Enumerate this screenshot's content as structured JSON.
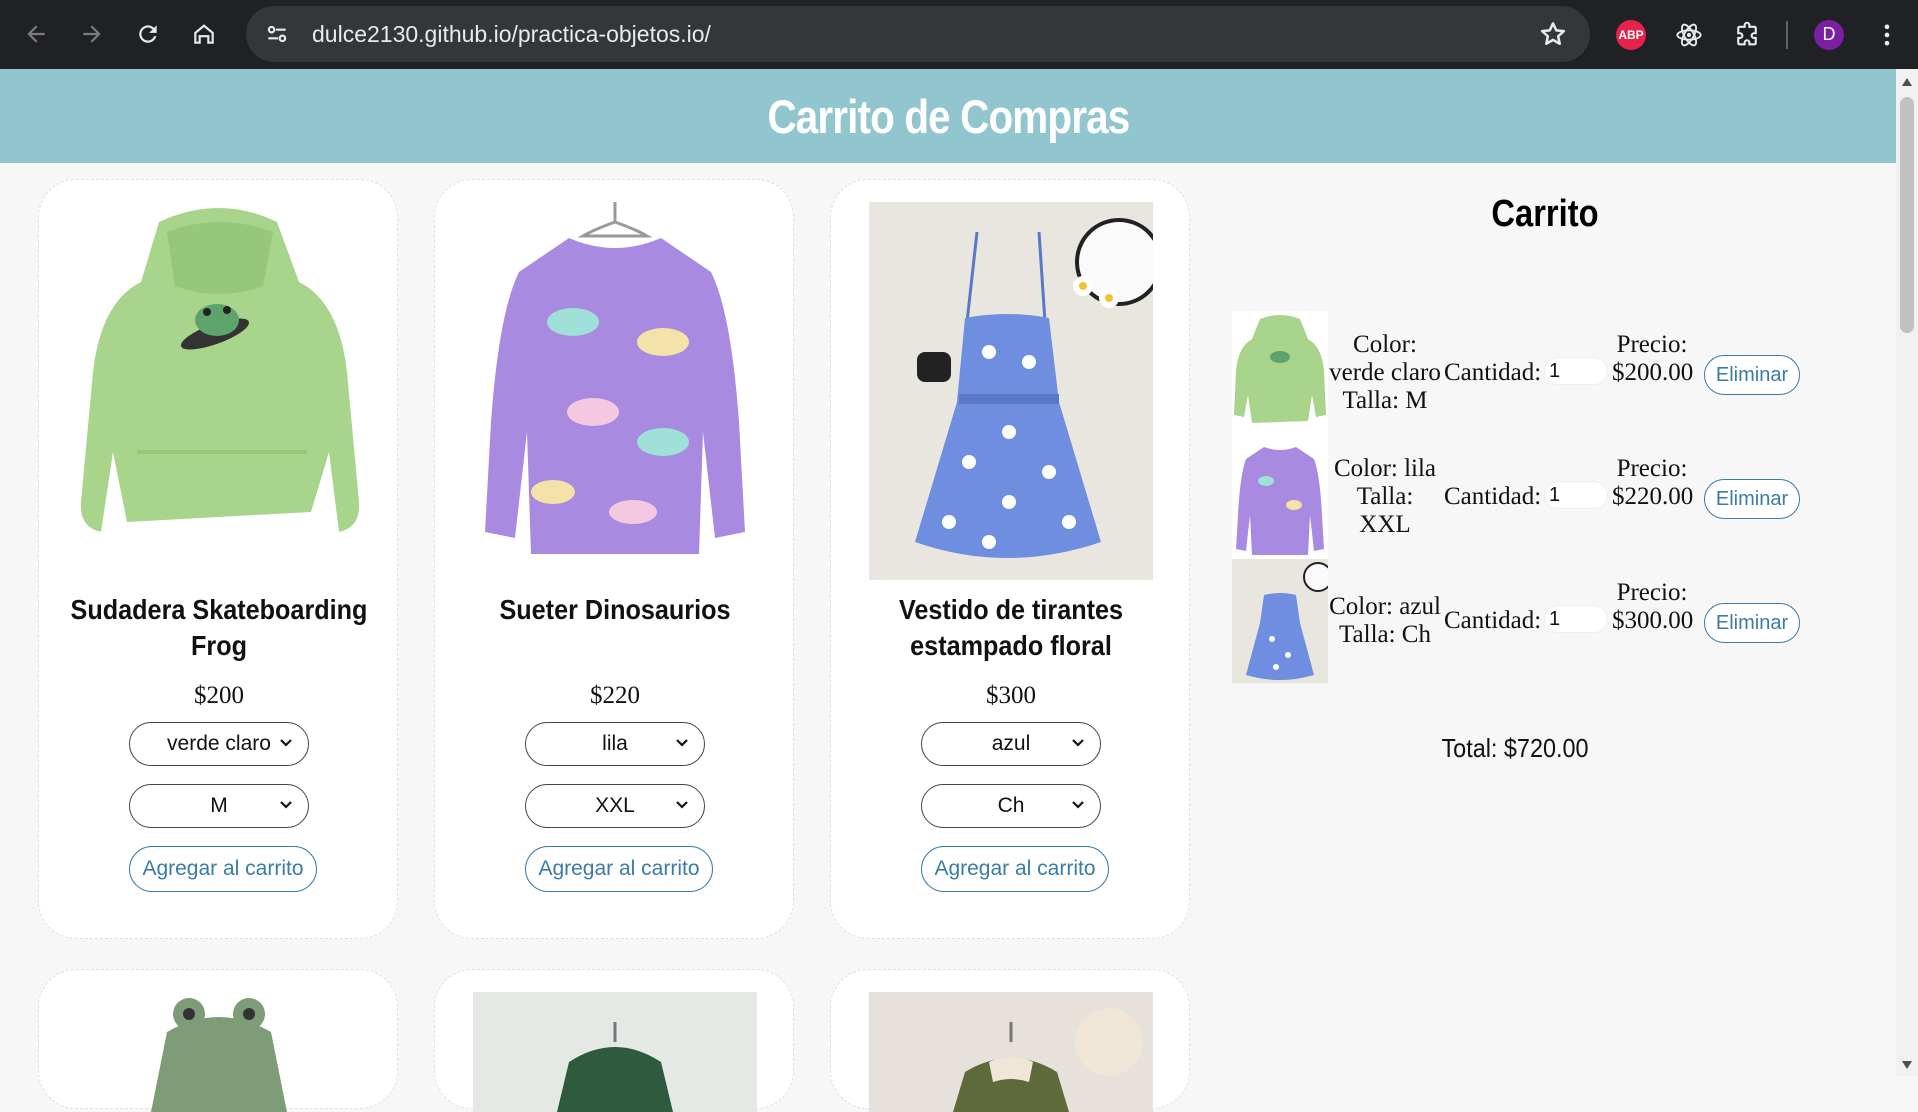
{
  "browser": {
    "url": "dulce2130.github.io/practica-objetos.io/",
    "abp_label": "ABP",
    "profile_initial": "D"
  },
  "page": {
    "title": "Carrito de Compras"
  },
  "products": [
    {
      "name": "Sudadera Skateboarding Frog",
      "price": "$200",
      "color": "verde claro",
      "size": "M",
      "add_label": "Agregar al carrito"
    },
    {
      "name": "Sueter Dinosaurios",
      "price": "$220",
      "color": "lila",
      "size": "XXL",
      "add_label": "Agregar al carrito"
    },
    {
      "name": "Vestido de tirantes estampado floral",
      "price": "$300",
      "color": "azul",
      "size": "Ch",
      "add_label": "Agregar al carrito"
    }
  ],
  "cart": {
    "title": "Carrito",
    "items": [
      {
        "color": "Color: verde claro",
        "size": "Talla: M",
        "qty_label": "Cantidad:",
        "qty": "1",
        "price_label": "Precio:",
        "price": "$200.00",
        "remove_label": "Eliminar"
      },
      {
        "color": "Color: lila",
        "size": "Talla: XXL",
        "qty_label": "Cantidad:",
        "qty": "1",
        "price_label": "Precio:",
        "price": "$220.00",
        "remove_label": "Eliminar"
      },
      {
        "color": "Color: azul",
        "size": "Talla: Ch",
        "qty_label": "Cantidad:",
        "qty": "1",
        "price_label": "Precio:",
        "price": "$300.00",
        "remove_label": "Eliminar"
      }
    ],
    "total": "Total: $720.00"
  },
  "colors": {
    "header_bg": "#92c6cf",
    "accent": "#3a7ca5",
    "hoodie": "#a8d48c",
    "sweater": "#a88be0",
    "dress": "#6f8ee0"
  }
}
